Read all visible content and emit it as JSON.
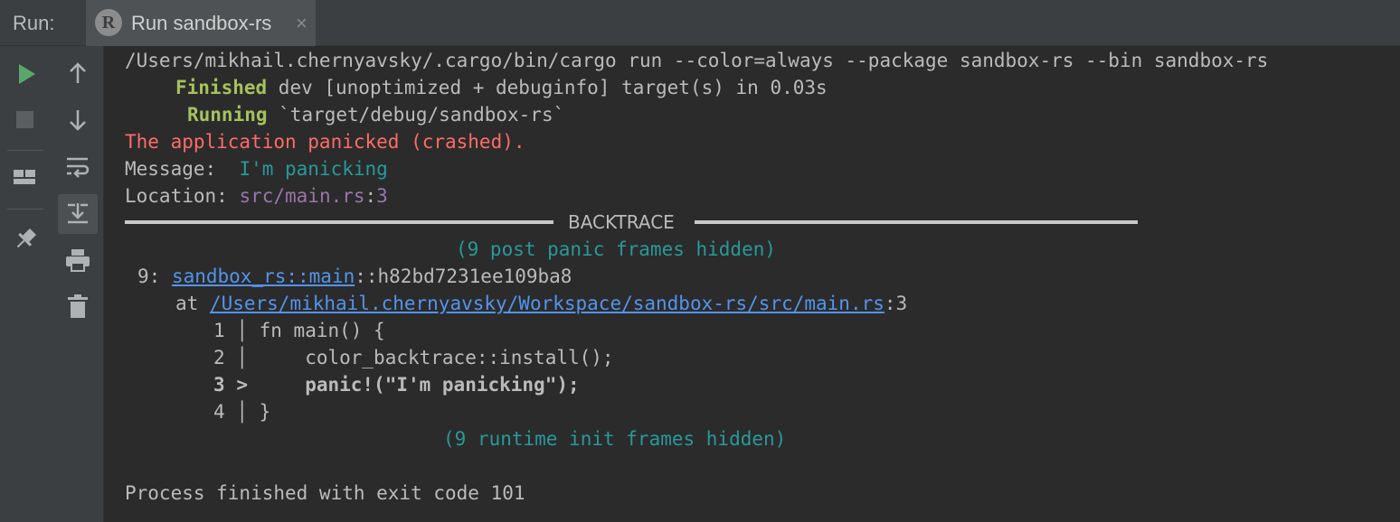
{
  "header": {
    "run_label": "Run:",
    "tab_title": "Run sandbox-rs",
    "tab_logo_letter": "R",
    "close_glyph": "×"
  },
  "toolbar_left": [
    "run-icon",
    "stop-icon",
    "layout-icon",
    "pin-icon"
  ],
  "toolbar_right": [
    "up-arrow-icon",
    "down-arrow-icon",
    "soft-wrap-icon",
    "scroll-to-end-icon",
    "print-icon",
    "trash-icon"
  ],
  "console": {
    "command": "/Users/mikhail.chernyavsky/.cargo/bin/cargo run --color=always --package sandbox-rs --bin sandbox-rs",
    "finished_keyword": "Finished",
    "finished_text": " dev [unoptimized + debuginfo] target(s) in 0.03s",
    "running_keyword": "Running",
    "running_text": " `target/debug/sandbox-rs`",
    "panic_text": "The application panicked (crashed).",
    "message_label": "Message:  ",
    "message_value": "I'm panicking",
    "location_label": "Location: ",
    "location_file": "src/main.rs",
    "location_sep": ":",
    "location_line": "3",
    "backtrace_title": "BACKTRACE",
    "post_panic_hidden": "(9 post panic frames hidden)",
    "frame_index": "9: ",
    "frame_path": "sandbox_rs::main",
    "frame_hash": "::h82bd7231ee109ba8",
    "at_label": "at ",
    "frame_file": "/Users/mikhail.chernyavsky/Workspace/sandbox-rs/src/main.rs",
    "frame_line": ":3",
    "code_lines": [
      {
        "num": "1",
        "marker": "│",
        "code": "fn main() {"
      },
      {
        "num": "2",
        "marker": "│",
        "code": "    color_backtrace::install();"
      },
      {
        "num": "3",
        "marker": ">",
        "code": "    panic!(\"I'm panicking\");"
      },
      {
        "num": "4",
        "marker": "│",
        "code": "}"
      }
    ],
    "runtime_hidden": "(9 runtime init frames hidden)",
    "exit_text": "Process finished with exit code 101"
  },
  "colors": {
    "green": "#a5c25c",
    "red": "#ff6b68",
    "cyan": "#299999",
    "purple": "#9876aa",
    "link": "#5394ec",
    "run_green": "#59a869"
  }
}
